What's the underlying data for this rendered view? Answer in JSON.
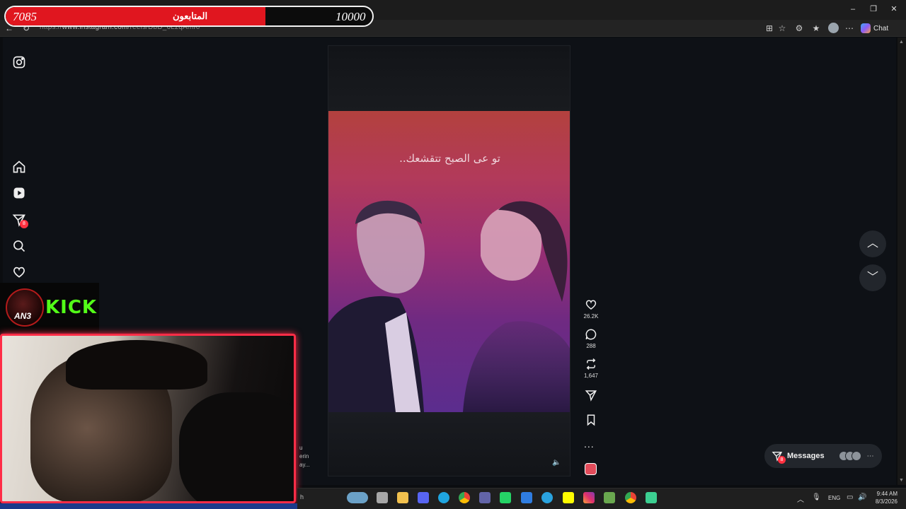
{
  "browser": {
    "url_prefix": "https://",
    "url_domain": "www.instagram.com",
    "url_path": "/reels/DbD_6LzqAmK/",
    "chat_label": "Chat",
    "window_controls": [
      "–",
      "❐",
      "✕"
    ]
  },
  "overlay": {
    "followers_current": "7085",
    "followers_label": "المتابعون",
    "followers_goal": "10000",
    "followers_progress": 0.7085,
    "kick_text": "KICK",
    "kick_logo_text": "AN3"
  },
  "sidebar": {
    "items": [
      {
        "name": "instagram-logo",
        "icon": "instagram-icon"
      },
      {
        "name": "home",
        "icon": "home-icon"
      },
      {
        "name": "reels",
        "icon": "reels-icon"
      },
      {
        "name": "messages",
        "icon": "send-icon",
        "badge": "8"
      },
      {
        "name": "search",
        "icon": "search-icon"
      },
      {
        "name": "notifications",
        "icon": "heart-icon"
      }
    ]
  },
  "reel": {
    "caption": "تو عى الصبح تتقشعك..",
    "colors": {
      "top": "#b3413e",
      "bottom": "#5b2d8e"
    },
    "mute_icon": "speaker-icon"
  },
  "actions": {
    "likes": "26.2K",
    "comments": "288",
    "reposts": "1,647",
    "more": "..."
  },
  "messages": {
    "label": "Messages",
    "badge": "8"
  },
  "comment_snippet": [
    "u",
    "erin",
    "ay..."
  ],
  "taskbar": {
    "search_fragment": "h",
    "lang": "ENG",
    "time": "9:44 AM",
    "date": "8/3/2026"
  }
}
